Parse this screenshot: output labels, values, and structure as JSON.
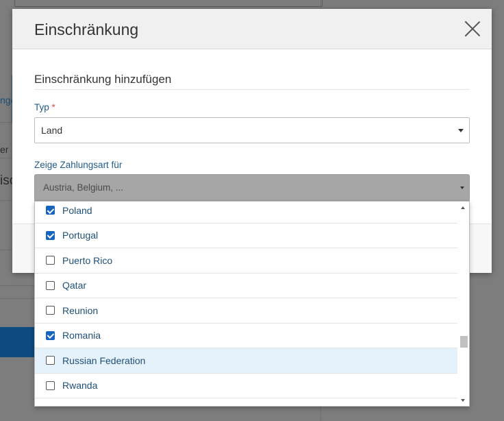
{
  "modal": {
    "title": "Einschränkung",
    "section_title": "Einschränkung hinzufügen",
    "typ_label": "Typ",
    "required_mark": "*",
    "typ_value": "Land",
    "zahlungsart_label": "Zeige Zahlungsart für",
    "zahlungsart_value": "Austria, Belgium, ..."
  },
  "background": {
    "frag1": "nge",
    "frag2": "er",
    "frag3": "isc"
  },
  "countries": [
    {
      "name": "Poland",
      "checked": true,
      "highlighted": false
    },
    {
      "name": "Portugal",
      "checked": true,
      "highlighted": false
    },
    {
      "name": "Puerto Rico",
      "checked": false,
      "highlighted": false
    },
    {
      "name": "Qatar",
      "checked": false,
      "highlighted": false
    },
    {
      "name": "Reunion",
      "checked": false,
      "highlighted": false
    },
    {
      "name": "Romania",
      "checked": true,
      "highlighted": false
    },
    {
      "name": "Russian Federation",
      "checked": false,
      "highlighted": true
    },
    {
      "name": "Rwanda",
      "checked": false,
      "highlighted": false
    }
  ],
  "colors": {
    "accent": "#1565c0",
    "highlight": "#e6f2fb",
    "label": "#1f5a8a"
  }
}
